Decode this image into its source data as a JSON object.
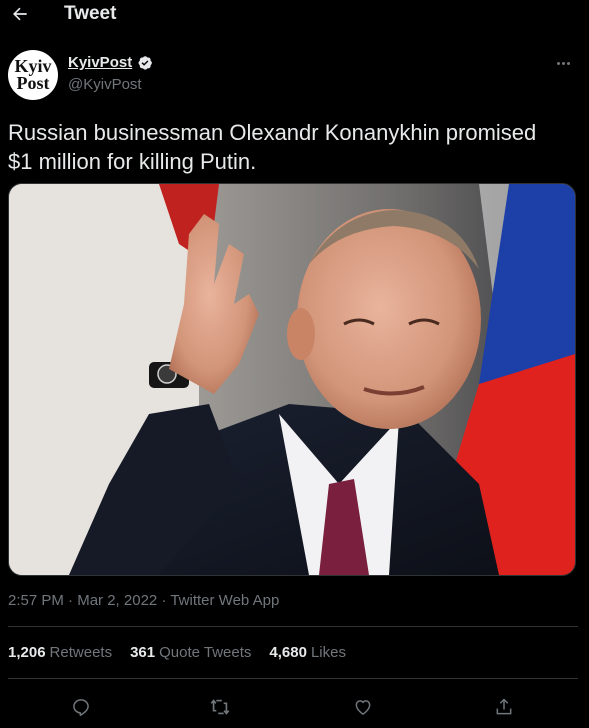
{
  "header": {
    "title": "Tweet",
    "back_icon": "arrow-left-icon"
  },
  "author": {
    "avatar_text_line1": "Kyiv",
    "avatar_text_line2": "Post",
    "name": "KyivPost",
    "handle": "@KyivPost",
    "verified_icon": "verified-badge-icon"
  },
  "tweet": {
    "text": "Russian businessman Olexandr Konanykhin promised\n$1 million for killing Putin."
  },
  "meta": {
    "time": "2:57 PM",
    "separator": "·",
    "date": "Mar 2, 2022",
    "source": "Twitter Web App"
  },
  "stats": {
    "retweets_count": "1,206",
    "retweets_label": "Retweets",
    "quotes_count": "361",
    "quotes_label": "Quote Tweets",
    "likes_count": "4,680",
    "likes_label": "Likes"
  },
  "actions": {
    "reply_icon": "reply-icon",
    "retweet_icon": "retweet-icon",
    "like_icon": "heart-icon",
    "share_icon": "share-icon"
  },
  "colors": {
    "background": "#000000",
    "text": "#e7e9ea",
    "secondary_text": "#71767b",
    "divider": "#2f3336",
    "verified": "#e7e9ea"
  }
}
